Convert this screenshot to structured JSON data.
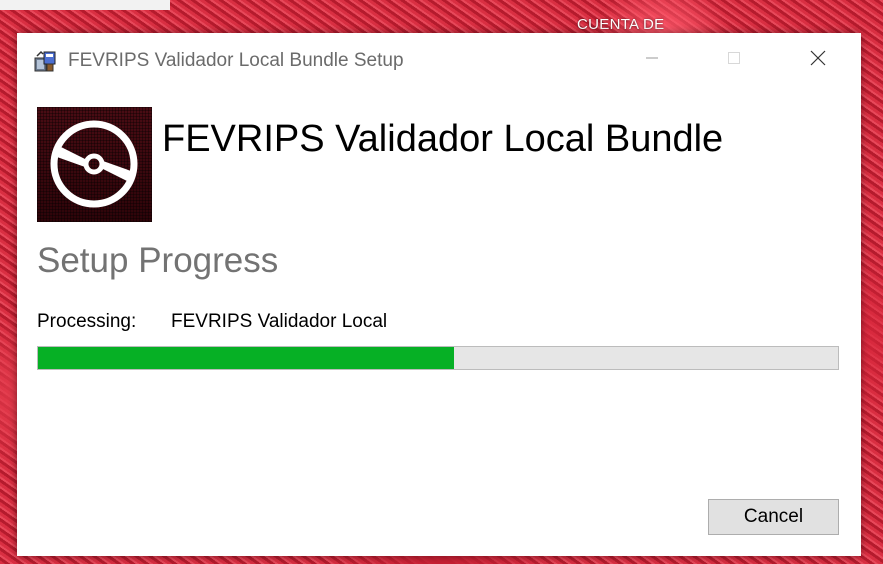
{
  "desktop": {
    "partial_text": "CUENTA DE"
  },
  "window": {
    "title": "FEVRIPS Validador Local Bundle Setup",
    "icon": "installer-package-icon",
    "controls": {
      "minimize_icon": "minimize-icon",
      "maximize_icon": "maximize-icon",
      "close_icon": "close-icon"
    }
  },
  "header": {
    "logo_icon": "disc-icon",
    "product_title": "FEVRIPS Validador Local Bundle"
  },
  "main": {
    "section_title": "Setup Progress",
    "processing_label": "Processing:",
    "processing_value": "FEVRIPS Validador Local",
    "progress_fraction": 0.52
  },
  "footer": {
    "cancel_label": "Cancel"
  },
  "colors": {
    "progress_fill": "#06b025",
    "progress_track": "#e6e6e6",
    "logo_bg": "#3a0a0f",
    "section_title": "#737373"
  }
}
